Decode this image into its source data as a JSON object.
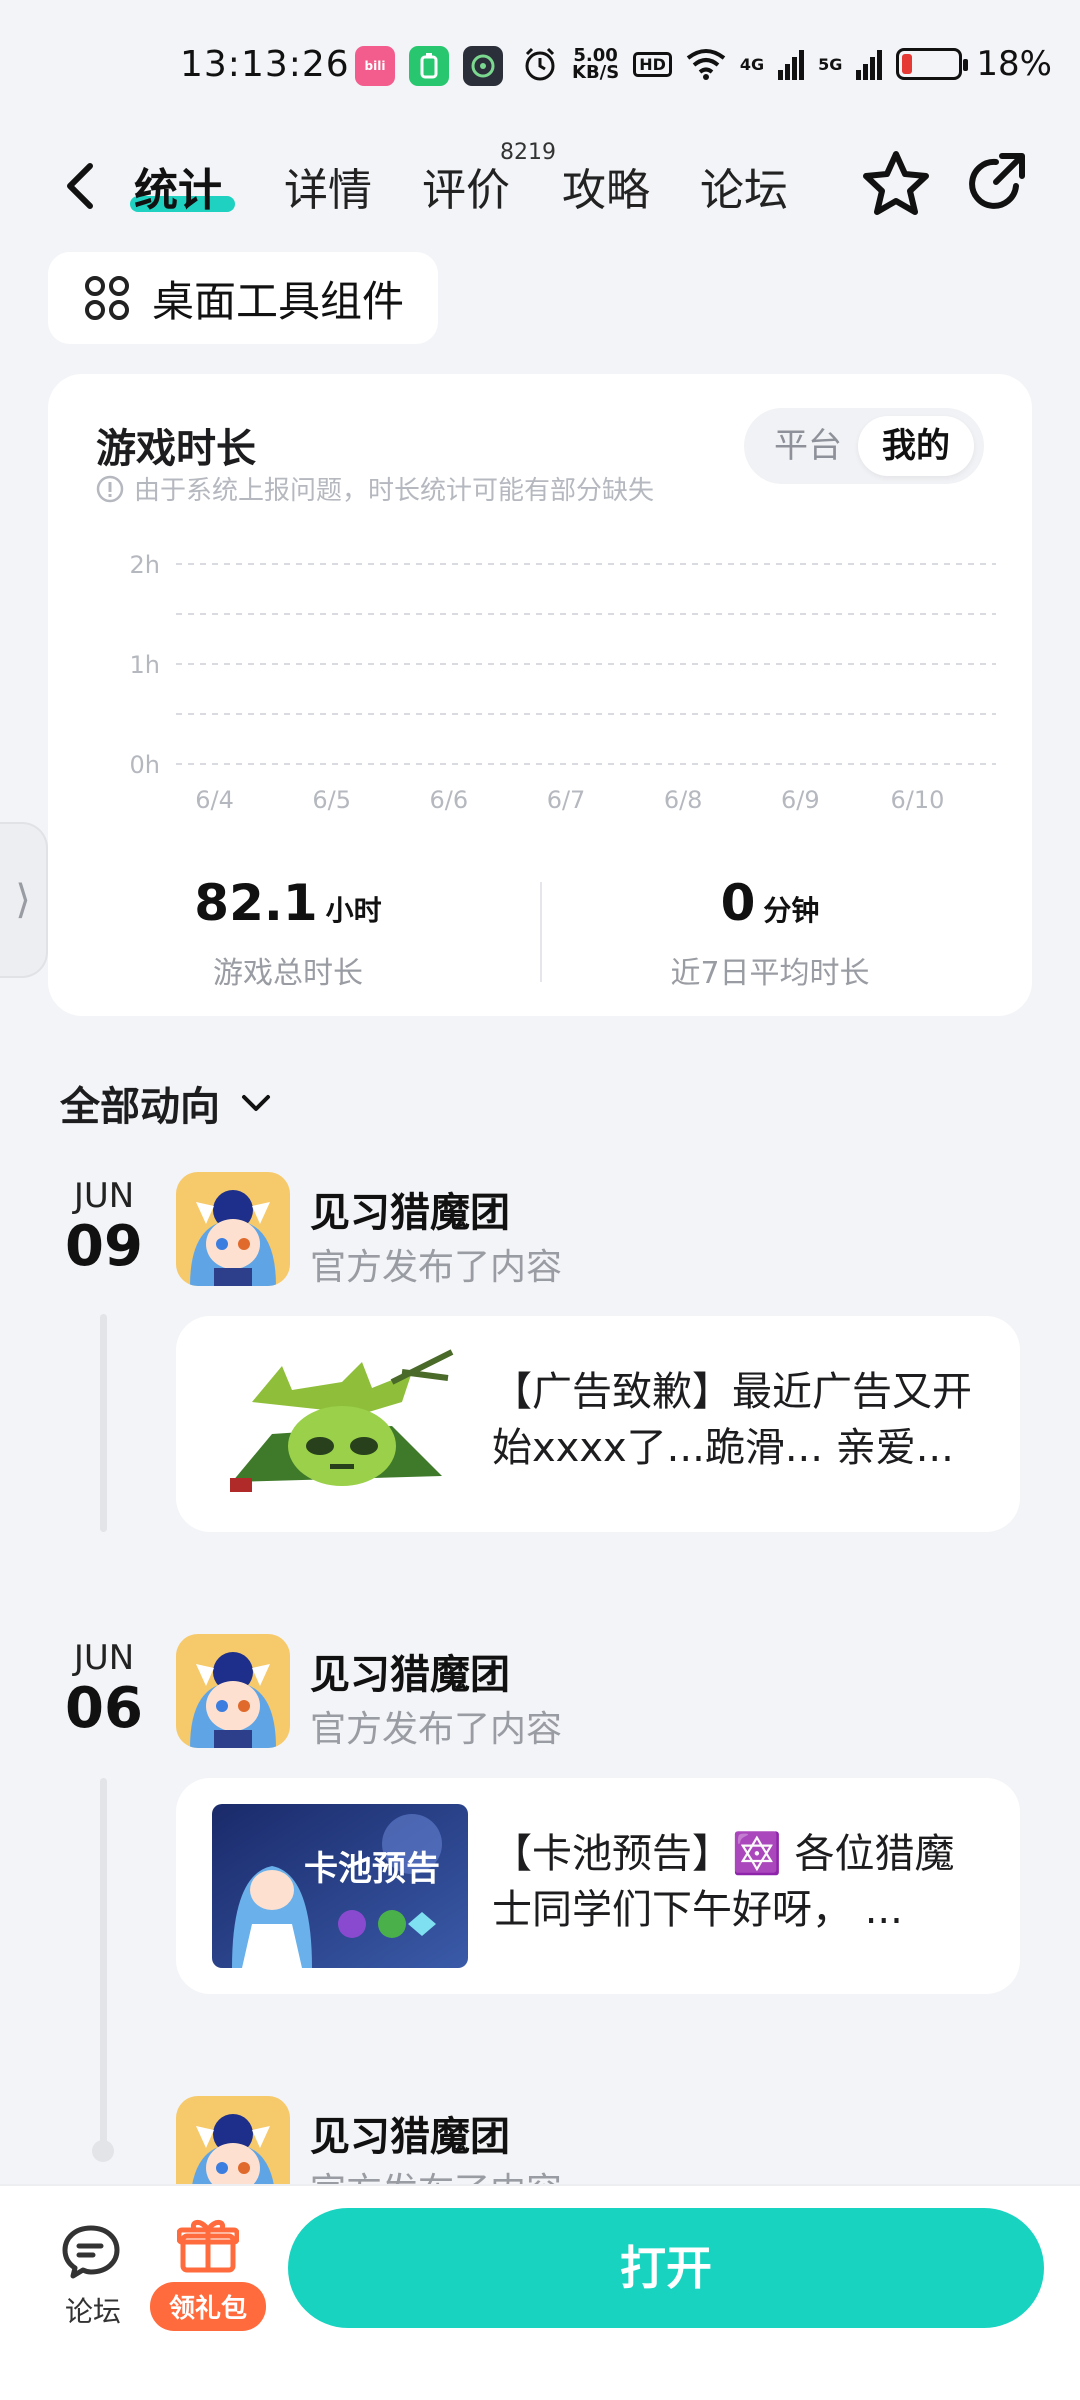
{
  "status_bar": {
    "time": "13:13:26",
    "net_speed_value": "5.00",
    "net_speed_unit": "KB/S",
    "hd": "HD",
    "sig1": "4G",
    "sig2": "5G",
    "battery_percent": "18%",
    "battery_level": 0.18,
    "app_bili": "bili",
    "app_icons": [
      "bilibili-icon",
      "battery-app-icon",
      "app-icon"
    ]
  },
  "nav": {
    "tabs": [
      {
        "label": "统计",
        "active": true
      },
      {
        "label": "详情"
      },
      {
        "label": "评价",
        "badge": "8219"
      },
      {
        "label": "攻略"
      },
      {
        "label": "论坛"
      }
    ]
  },
  "widget_chip": {
    "label": "桌面工具组件"
  },
  "stats_card": {
    "title": "游戏时长",
    "note": "由于系统上报问题，时长统计可能有部分缺失",
    "toggle": {
      "platform": "平台",
      "mine": "我的",
      "selected": "mine"
    },
    "total": {
      "value": "82.1",
      "unit": "小时",
      "label": "游戏总时长"
    },
    "average": {
      "value": "0",
      "unit": "分钟",
      "label": "近7日平均时长"
    }
  },
  "chart_data": {
    "type": "bar",
    "categories": [
      "6/4",
      "6/5",
      "6/6",
      "6/7",
      "6/8",
      "6/9",
      "6/10"
    ],
    "values": [
      0,
      0,
      0,
      0,
      0,
      0,
      0
    ],
    "y_tick_labels": [
      "2h",
      "1h",
      "0h"
    ],
    "y_ticks": [
      2,
      1,
      0
    ],
    "ylim": [
      0,
      2
    ],
    "grid": true,
    "title": "",
    "xlabel": "",
    "ylabel": ""
  },
  "activity": {
    "section_title": "全部动向",
    "posts": [
      {
        "month": "JUN",
        "day": "09",
        "author": "见习猎魔团",
        "subtitle": "官方发布了内容",
        "text": "【广告致歉】最近广告又开始xxxx了...跪滑... 亲爱..."
      },
      {
        "month": "JUN",
        "day": "06",
        "author": "见习猎魔团",
        "subtitle": "官方发布了内容",
        "text": "【卡池预告】🔯 各位猎魔士同学们下午好呀， ...",
        "thumb_caption": "卡池预告"
      },
      {
        "author": "见习猎魔团",
        "subtitle": "官方发布了内容"
      }
    ]
  },
  "bottom_bar": {
    "forum_label": "论坛",
    "gift_label": "领礼包",
    "open_label": "打开"
  }
}
